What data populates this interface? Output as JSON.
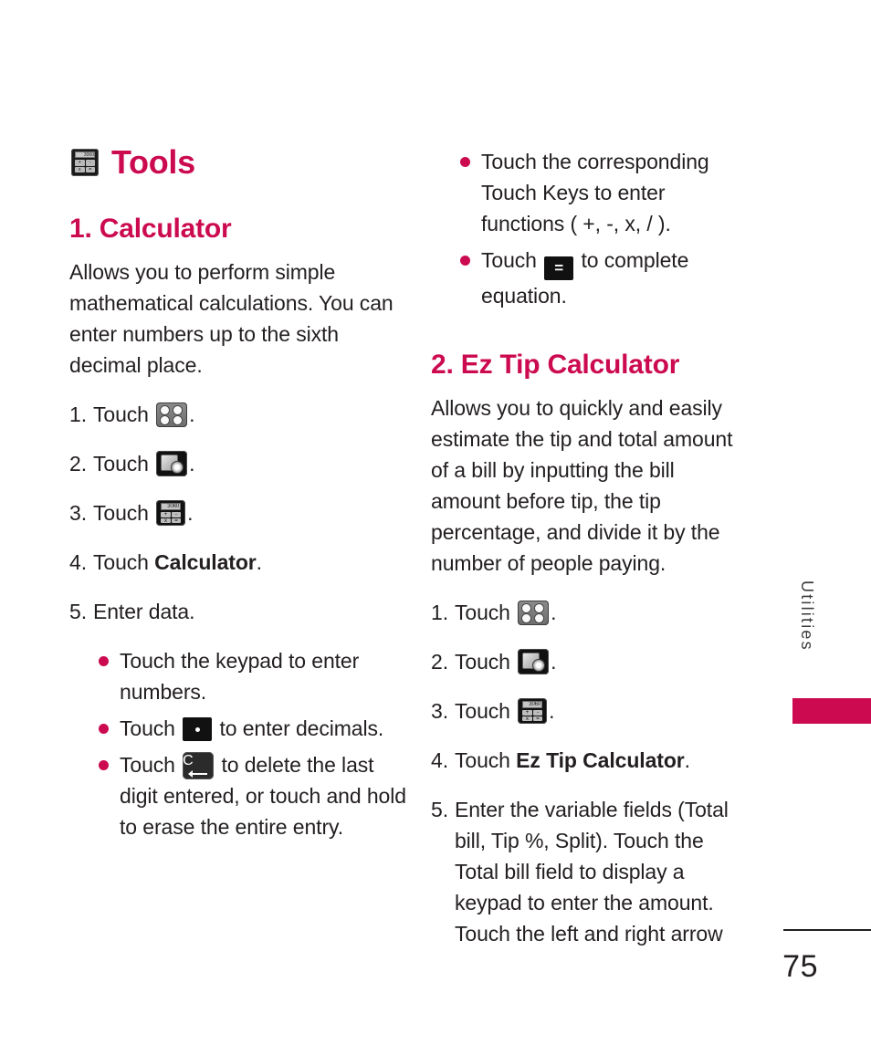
{
  "chapter": {
    "title": "Tools",
    "icon": "calculator-icon",
    "icon_display": "3060",
    "icon_keys": [
      "+",
      "-",
      "x",
      "="
    ]
  },
  "accent_color": "#cc0a4f",
  "text_color": "#231f20",
  "side_tab": {
    "label": "Utilities",
    "block_color": "#cc0a4f"
  },
  "footer": {
    "page_number": "75"
  },
  "sections": [
    {
      "heading": "1. Calculator",
      "intro": "Allows you to perform simple mathematical calculations. You can enter numbers up to the sixth decimal place.",
      "steps": [
        {
          "num": "1.",
          "pre": "Touch",
          "icon": "grid-menu-icon",
          "post": "."
        },
        {
          "num": "2.",
          "pre": "Touch",
          "icon": "tools-icon",
          "post": "."
        },
        {
          "num": "3.",
          "pre": "Touch",
          "icon": "calculator-icon",
          "post": "."
        },
        {
          "num": "4.",
          "pre": "Touch",
          "bold": "Calculator",
          "post": "."
        },
        {
          "num": "5.",
          "text": "Enter data."
        }
      ],
      "bullets": [
        {
          "text": "Touch the keypad to enter numbers."
        },
        {
          "pre": "Touch",
          "icon": "decimal-key-icon",
          "post": "to enter decimals."
        },
        {
          "pre": "Touch",
          "icon": "clear-key-icon",
          "post": "to delete the last digit entered, or touch and hold to erase the entire entry."
        },
        {
          "text": "Touch the corresponding Touch Keys to enter functions ( +, -, x, / )."
        },
        {
          "pre": "Touch",
          "icon": "equals-key-icon",
          "post": "to complete equation."
        }
      ]
    },
    {
      "heading": "2. Ez Tip Calculator",
      "intro": "Allows you to quickly and easily estimate the tip and total amount of a bill by inputting the bill amount before tip, the tip percentage, and divide it by the number of people paying.",
      "steps": [
        {
          "num": "1.",
          "pre": "Touch",
          "icon": "grid-menu-icon",
          "post": "."
        },
        {
          "num": "2.",
          "pre": "Touch",
          "icon": "tools-icon",
          "post": "."
        },
        {
          "num": "3.",
          "pre": "Touch",
          "icon": "calculator-icon",
          "post": "."
        },
        {
          "num": "4.",
          "pre": "Touch",
          "bold": "Ez Tip Calculator",
          "post": "."
        },
        {
          "num": "5.",
          "text": "Enter the variable fields (Total bill, Tip %, Split). Touch the Total bill field to display a keypad to enter the amount. Touch the left and right arrow"
        }
      ]
    }
  ]
}
